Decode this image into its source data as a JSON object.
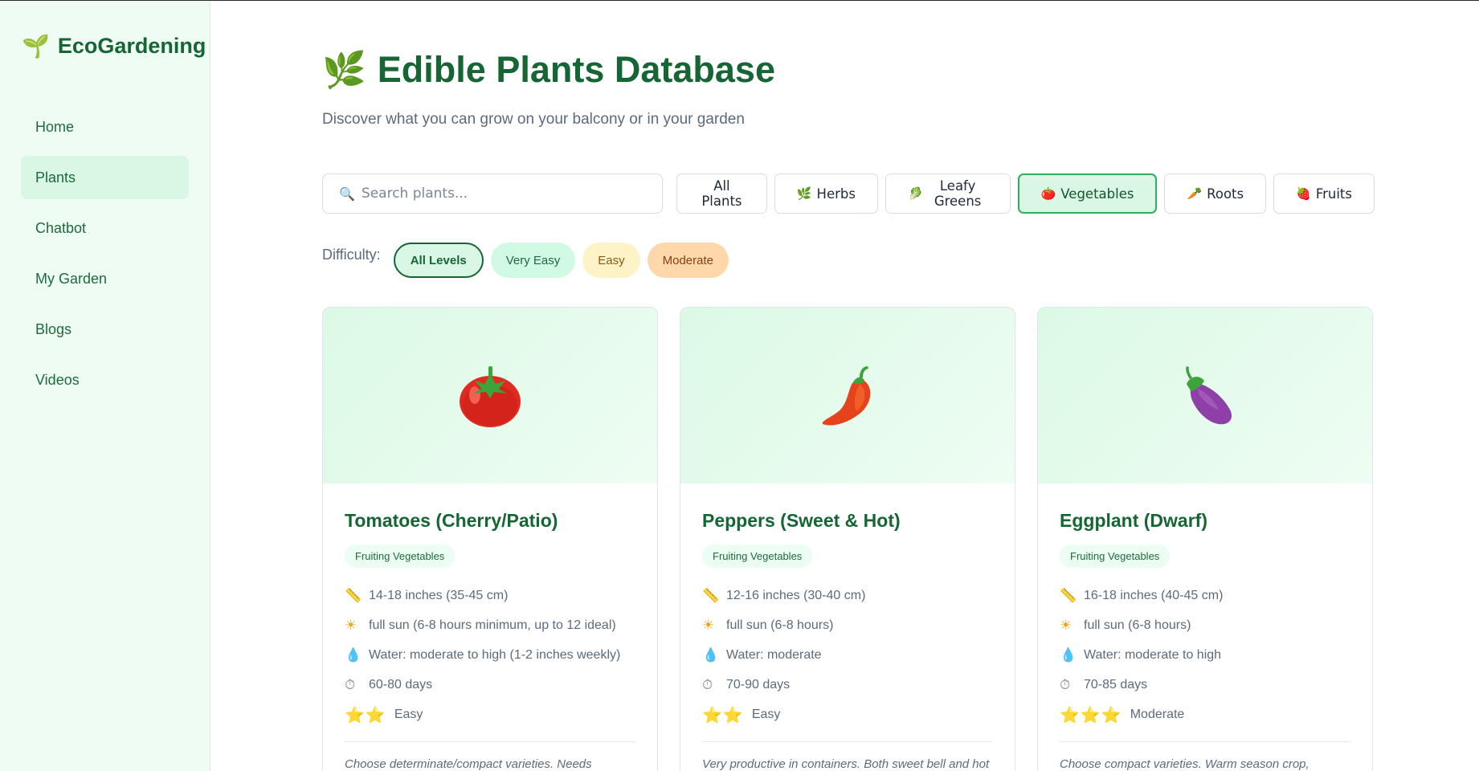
{
  "brand": {
    "logo_glyph": "🌱",
    "name": "EcoGardening"
  },
  "nav": [
    {
      "label": "Home",
      "active": false
    },
    {
      "label": "Plants",
      "active": true
    },
    {
      "label": "Chatbot",
      "active": false
    },
    {
      "label": "My Garden",
      "active": false
    },
    {
      "label": "Blogs",
      "active": false
    },
    {
      "label": "Videos",
      "active": false
    }
  ],
  "header": {
    "icon_glyph": "🌿",
    "title": "Edible Plants Database",
    "subtitle": "Discover what you can grow on your balcony or in your garden"
  },
  "search": {
    "icon_glyph": "🔍",
    "placeholder": "Search plants...",
    "value": ""
  },
  "categories": [
    {
      "label": "All Plants",
      "icon": "",
      "active": false
    },
    {
      "label": "Herbs",
      "icon": "🌿",
      "active": false
    },
    {
      "label": "Leafy Greens",
      "icon": "🥬",
      "active": false
    },
    {
      "label": "Vegetables",
      "icon": "🍅",
      "active": true
    },
    {
      "label": "Roots",
      "icon": "🥕",
      "active": false
    },
    {
      "label": "Fruits",
      "icon": "🍓",
      "active": false
    }
  ],
  "difficulty": {
    "label": "Difficulty:",
    "options": [
      "All Levels",
      "Very Easy",
      "Easy",
      "Moderate"
    ],
    "selected": "All Levels"
  },
  "colors": {
    "primary": "#166534",
    "accent": "#2fae5f",
    "sidebar_bg": "#effcf4",
    "hero_bg": "#dcf9e6"
  },
  "plants": [
    {
      "name": "Tomatoes (Cherry/Patio)",
      "image": "tomato-icon",
      "category": "Fruiting Vegetables",
      "size": "14-18 inches (35-45 cm)",
      "sun": "full sun (6-8 hours minimum, up to 12 ideal)",
      "water": "Water: moderate to high (1-2 inches weekly)",
      "days": "60-80 days",
      "stars": "⭐⭐",
      "difficulty": "Easy",
      "description": "Choose determinate/compact varieties. Needs support/ cage. Water deeply at base, avoid wetting foliage."
    },
    {
      "name": "Peppers (Sweet & Hot)",
      "image": "pepper-icon",
      "category": "Fruiting Vegetables",
      "size": "12-16 inches (30-40 cm)",
      "sun": "full sun (6-8 hours)",
      "water": "Water: moderate",
      "days": "70-90 days",
      "stars": "⭐⭐",
      "difficulty": "Easy",
      "description": "Very productive in containers. Both sweet bell and hot chili varieties work well."
    },
    {
      "name": "Eggplant (Dwarf)",
      "image": "eggplant-icon",
      "category": "Fruiting Vegetables",
      "size": "16-18 inches (40-45 cm)",
      "sun": "full sun (6-8 hours)",
      "water": "Water: moderate to high",
      "days": "70-85 days",
      "stars": "⭐⭐⭐",
      "difficulty": "Moderate",
      "description": "Choose compact varieties. Warm season crop, sensitive to cold."
    }
  ]
}
